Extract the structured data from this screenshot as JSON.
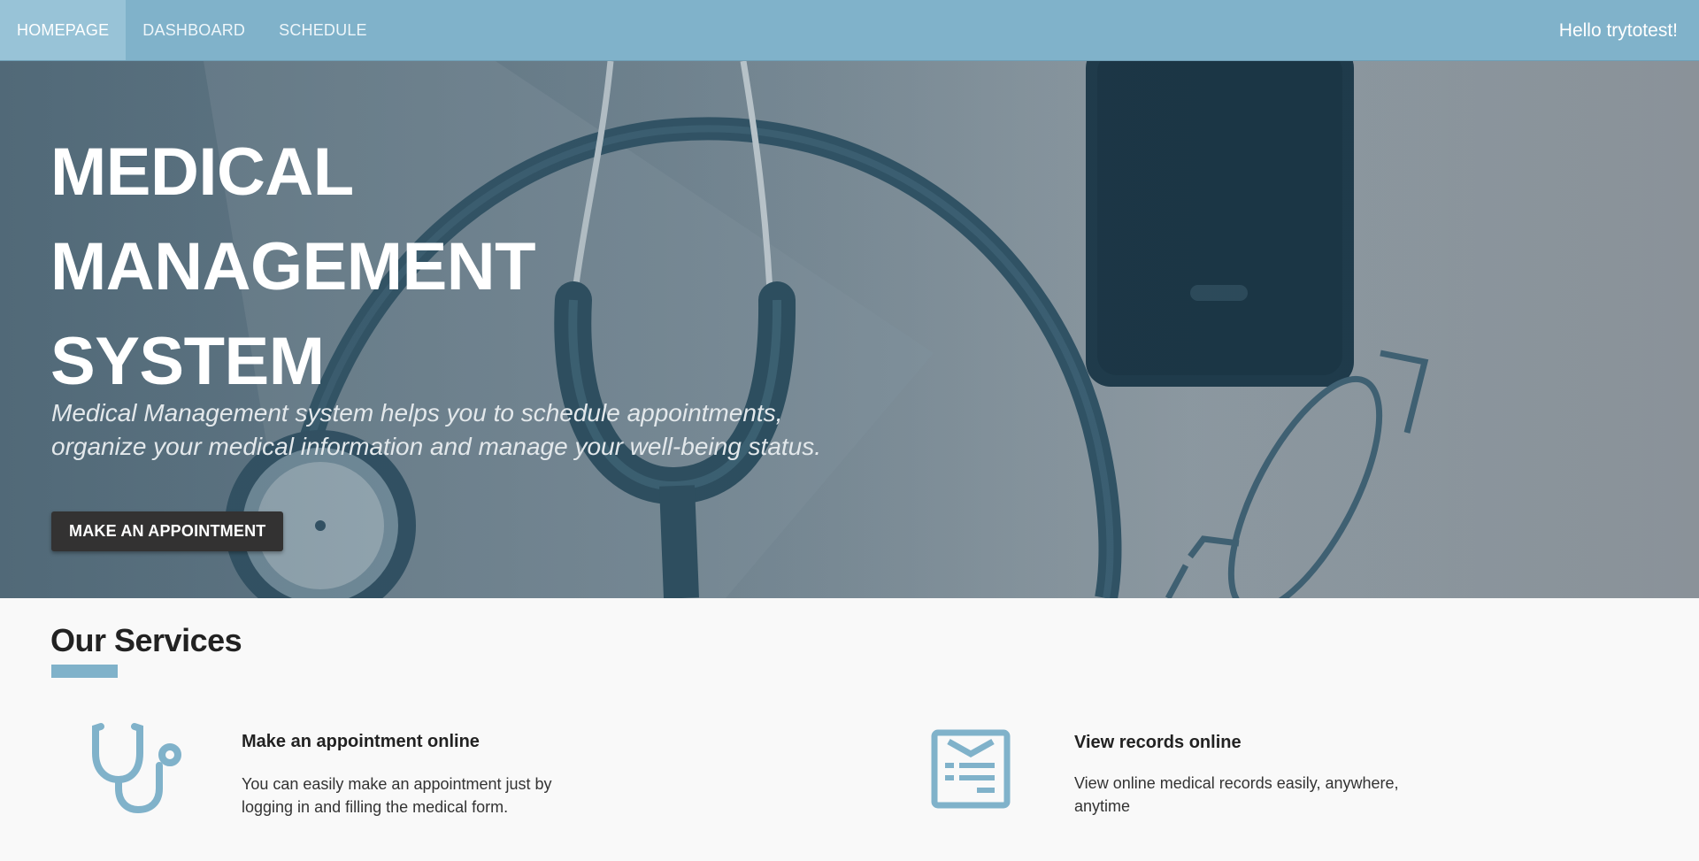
{
  "nav": {
    "items": [
      {
        "label": "HOMEPAGE",
        "active": true
      },
      {
        "label": "DASHBOARD",
        "active": false
      },
      {
        "label": "SCHEDULE",
        "active": false
      }
    ],
    "greeting": "Hello trytotest!"
  },
  "hero": {
    "title_line1": "MEDICAL",
    "title_line2": "MANAGEMENT",
    "title_line3": "SYSTEM",
    "subtitle_line1": "Medical Management system helps you to schedule appointments,",
    "subtitle_line2": "organize your medical information and manage your well-being status.",
    "cta_label": "MAKE AN APPOINTMENT"
  },
  "services": {
    "title": "Our Services",
    "items": [
      {
        "icon": "stethoscope-icon",
        "title": "Make an appointment online",
        "desc_line1": "You can easily make an appointment just by",
        "desc_line2": "logging in and filling the medical form."
      },
      {
        "icon": "records-icon",
        "title": "View records online",
        "desc_line1": "View online medical records easily, anywhere,",
        "desc_line2": "anytime"
      }
    ]
  },
  "colors": {
    "navbar": "#80b2ca",
    "nav_active": "#98c3d7",
    "accent": "#80b2ca",
    "button": "#333232"
  }
}
